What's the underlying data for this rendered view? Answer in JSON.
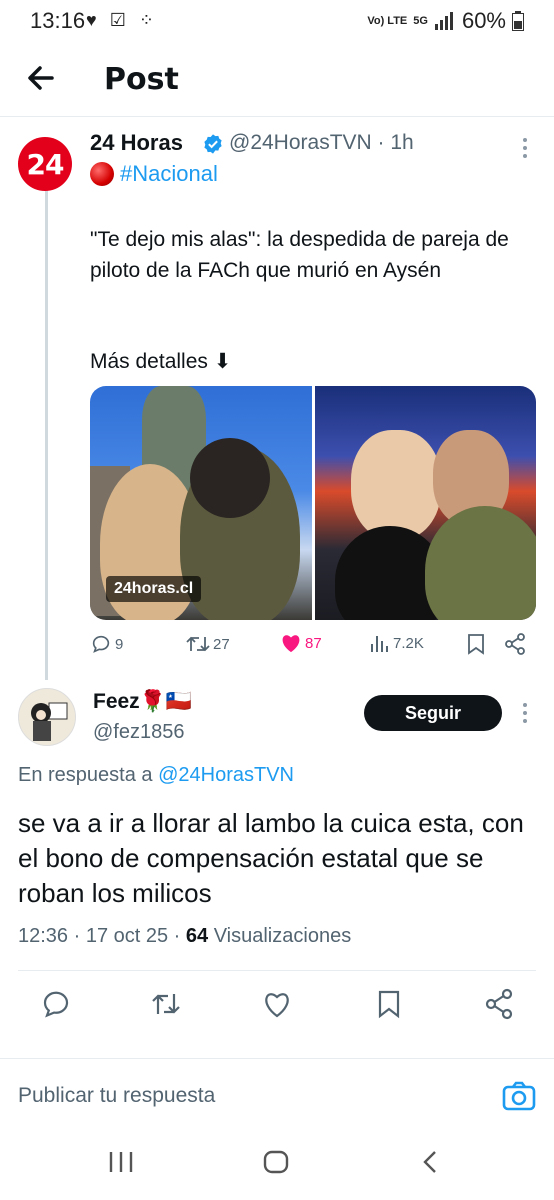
{
  "status": {
    "time": "13:16",
    "network": "5G",
    "volte": "Vo) LTE",
    "battery": "60%"
  },
  "header": {
    "title": "Post"
  },
  "tweet": {
    "author_name": "24 Horas",
    "avatar_text": "24",
    "handle": "@24HorasTVN",
    "time": "· 1h",
    "hashtag": "#Nacional",
    "text": " \"Te dejo mis alas\": la despedida de pareja de piloto de la FACh que murió en Aysén",
    "more": "Más detalles ⬇",
    "media_source": "24horas.cl",
    "stats": {
      "replies": "9",
      "retweets": "27",
      "likes": "87",
      "views": "7.2K"
    }
  },
  "reply": {
    "author_name": "Feez🌹🇨🇱",
    "handle": "@fez1856",
    "follow_label": "Seguir",
    "reply_to_prefix": "En respuesta a",
    "reply_to_handle": "@24HorasTVN",
    "text": "se va a ir a llorar al lambo la cuica esta, con el bono de compensación estatal que se roban los milicos",
    "timestamp": "12:36 · 17 oct 25 · ",
    "views_count": "64",
    "views_label": " Visualizaciones"
  },
  "composer": {
    "placeholder": "Publicar tu respuesta"
  },
  "colors": {
    "accent": "#1d9bf0",
    "like": "#f91880",
    "brand_red": "#e3001b"
  }
}
